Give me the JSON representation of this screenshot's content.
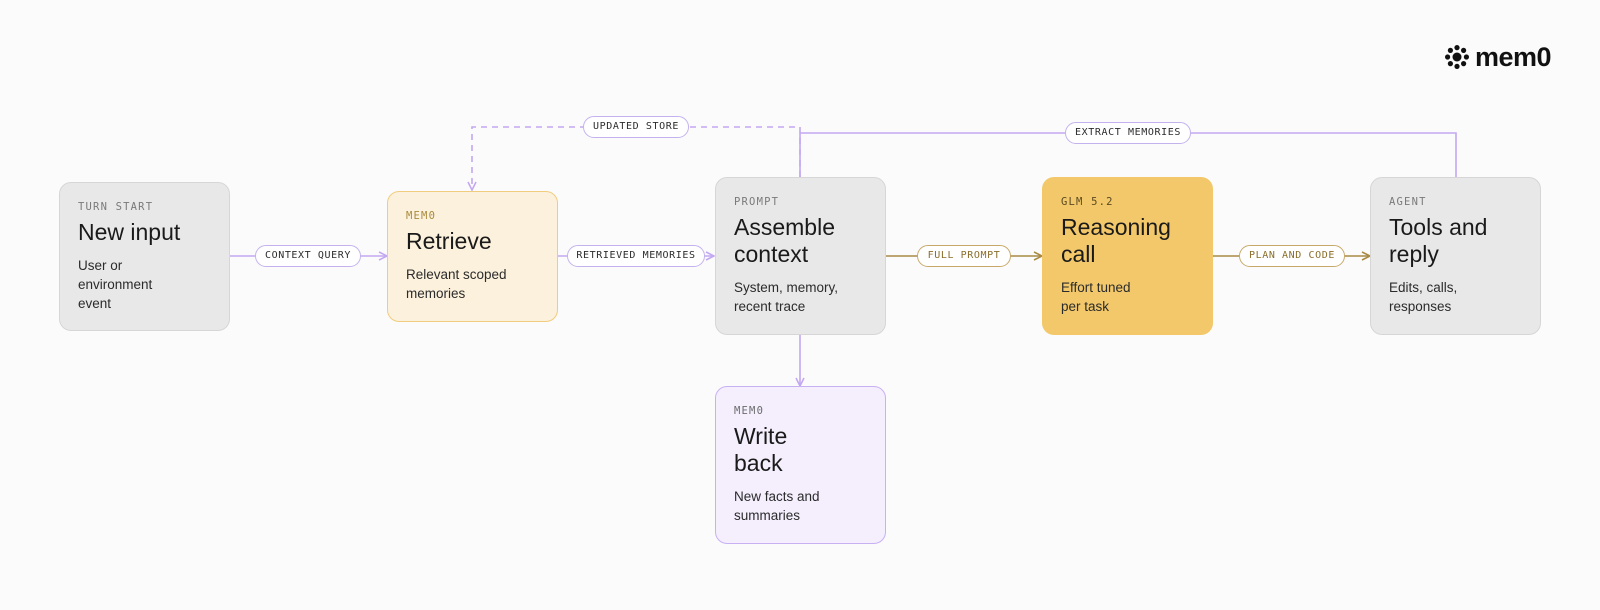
{
  "brand": {
    "name": "mem0",
    "logo_icon": "flower-icon"
  },
  "nodes": {
    "new_input": {
      "tag": "TURN START",
      "title": "New input",
      "desc": "User or\nenvironment\nevent"
    },
    "retrieve": {
      "tag": "MEM0",
      "title": "Retrieve",
      "desc": "Relevant scoped\nmemories"
    },
    "assemble": {
      "tag": "PROMPT",
      "title": "Assemble\ncontext",
      "desc": "System, memory,\nrecent trace"
    },
    "reasoning": {
      "tag": "GLM 5.2",
      "title": "Reasoning\ncall",
      "desc": "Effort tuned\nper task"
    },
    "tools": {
      "tag": "AGENT",
      "title": "Tools and\nreply",
      "desc": "Edits, calls,\nresponses"
    },
    "write_back": {
      "tag": "MEM0",
      "title": "Write\nback",
      "desc": "New facts and\nsummaries"
    }
  },
  "edges": {
    "context_query": "CONTEXT QUERY",
    "retrieved_memories": "RETRIEVED MEMORIES",
    "full_prompt": "FULL PROMPT",
    "plan_and_code": "PLAN AND CODE",
    "updated_store": "UPDATED STORE",
    "extract_memories": "EXTRACT MEMORIES"
  },
  "colors": {
    "purple_edge": "#c3a8f2",
    "gold_edge": "#a98a45",
    "yellow_node": "#f2c86a",
    "yellow_light_node": "#fcf1dc",
    "purple_light_node": "#f4eefd",
    "grey_node": "#e8e8e8"
  }
}
